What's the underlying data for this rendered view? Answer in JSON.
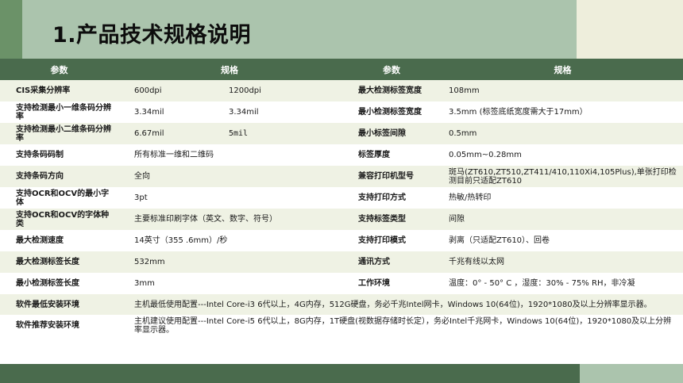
{
  "title": "1.产品技术规格说明",
  "headers": [
    "参数",
    "规格",
    "参数",
    "规格"
  ],
  "rows": [
    {
      "k1": "CIS采集分辨率",
      "v1a": "600dpi",
      "v1b": "1200dpi",
      "k2": "最大检测标签宽度",
      "v2": "108mm"
    },
    {
      "k1": "支持检测最小一维条码分辨率",
      "v1a": "3.34mil",
      "v1b": "3.34mil",
      "k2": "最小检测标签宽度",
      "v2": "3.5mm (标签底纸宽度需大于17mm）"
    },
    {
      "k1": "支持检测最小二维条码分辨率",
      "v1a": "6.67mil",
      "v1b": "5mil",
      "k2": "最小标签间隙",
      "v2": "0.5mm"
    },
    {
      "k1": "支持条码码制",
      "v1": "所有标准一维和二维码",
      "k2": "标签厚度",
      "v2": "0.05mm~0.28mm"
    },
    {
      "k1": "支持条码方向",
      "v1": "全向",
      "k2": "兼容打印机型号",
      "v2": "斑马(ZT610,ZT510,ZT411/410,110Xi4,105Plus),单张打印检测目前只适配ZT610"
    },
    {
      "k1": "支持OCR和OCV的最小字体",
      "v1": "3pt",
      "k2": "支持打印方式",
      "v2": "热敏/热转印"
    },
    {
      "k1": "支持OCR和OCV的字体种类",
      "v1": "主要标准印刷字体（英文、数字、符号）",
      "k2": "支持标签类型",
      "v2": "间隙"
    },
    {
      "k1": "最大检测速度",
      "v1": "14英寸（355 .6mm）/秒",
      "k2": "支持打印模式",
      "v2": "剥离（只适配ZT610）、回卷"
    },
    {
      "k1": "最大检测标签长度",
      "v1": "532mm",
      "k2": "通讯方式",
      "v2": "千兆有线以太网"
    },
    {
      "k1": "最小检测标签长度",
      "v1": "3mm",
      "k2": "工作环境",
      "v2": "温度：0° - 50° C ，湿度：30% - 75% RH，非冷凝"
    },
    {
      "k1": "软件最低安装环境",
      "v1": "主机最低使用配置---Intel Core-i3 6代以上，4G内存，512G硬盘，务必千兆Intel网卡，Windows 10(64位)，1920*1080及以上分辨率显示器。"
    },
    {
      "k1": "软件推荐安装环境",
      "v1": "主机建议使用配置---Intel Core-i5 6代以上，8G内存，1T硬盘(视数据存储时长定），务必Intel千兆网卡，Windows 10(64位)，1920*1080及以上分辨率显示器。"
    }
  ]
}
